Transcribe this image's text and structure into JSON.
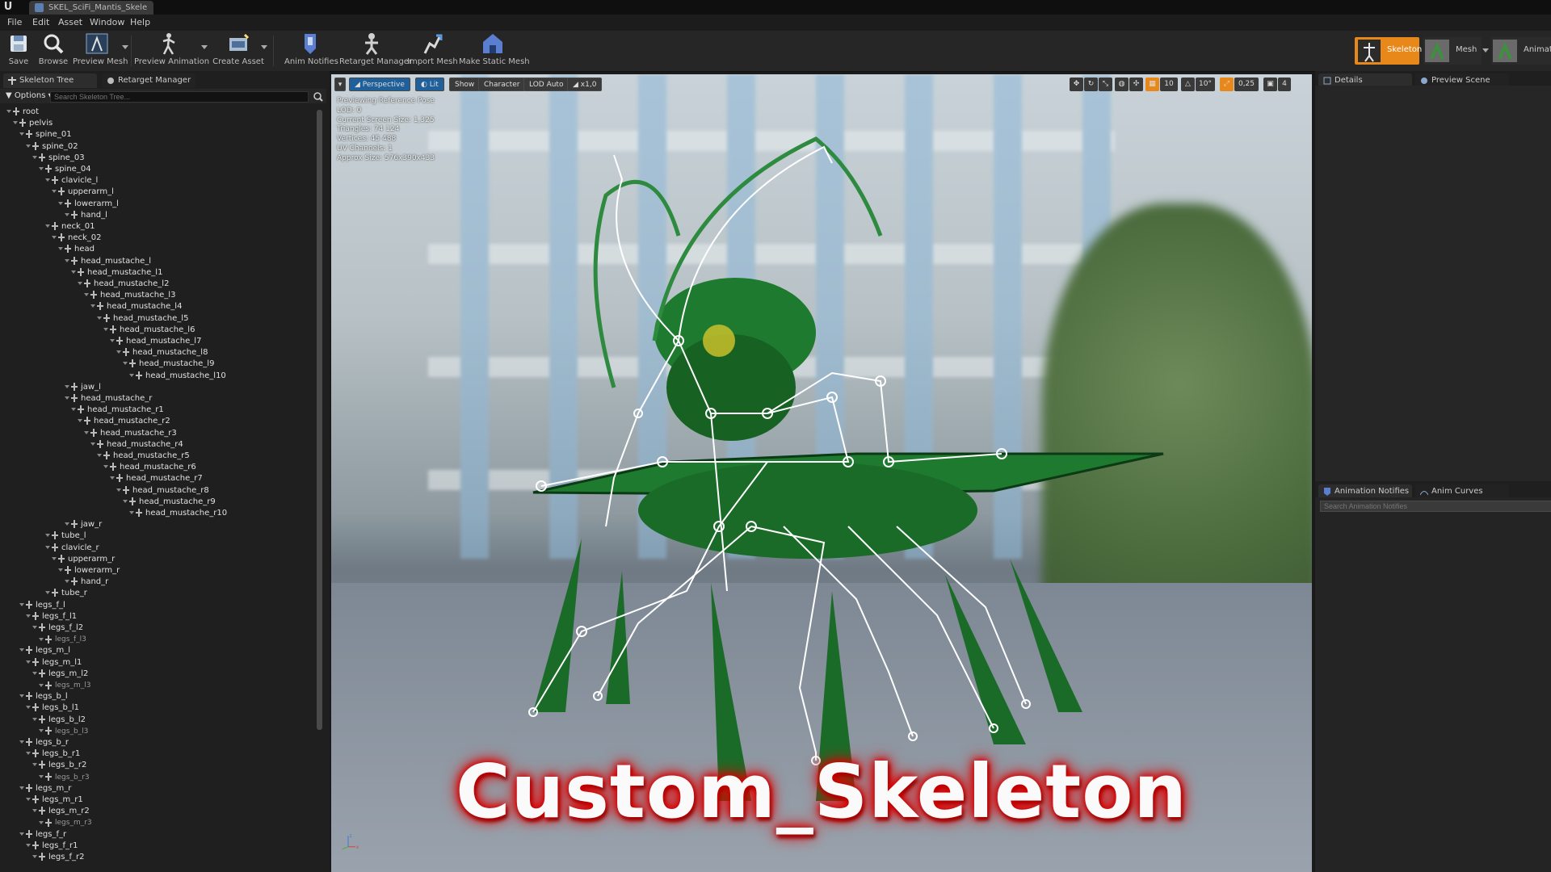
{
  "window": {
    "tab_title": "SKEL_SciFi_Mantis_Skele"
  },
  "menu": [
    "File",
    "Edit",
    "Asset",
    "Window",
    "Help"
  ],
  "toolbar": {
    "buttons": [
      {
        "label": "Save",
        "icon": "save-icon"
      },
      {
        "label": "Browse",
        "icon": "browse-icon"
      },
      {
        "label": "Preview Mesh",
        "icon": "preview-mesh-icon"
      },
      {
        "label": "Preview Animation",
        "icon": "preview-animation-icon"
      },
      {
        "label": "Create Asset",
        "icon": "create-asset-icon"
      },
      {
        "label": "Anim Notifies",
        "icon": "anim-notifies-icon"
      },
      {
        "label": "Retarget Manager",
        "icon": "retarget-manager-icon"
      },
      {
        "label": "Import Mesh",
        "icon": "import-mesh-icon"
      },
      {
        "label": "Make Static Mesh",
        "icon": "make-static-mesh-icon"
      }
    ],
    "modes": [
      {
        "label": "Skeleton",
        "active": true
      },
      {
        "label": "Mesh",
        "active": false
      },
      {
        "label": "Animati",
        "active": false
      }
    ]
  },
  "left_panel": {
    "tabs": [
      "Skeleton Tree",
      "Retarget Manager"
    ],
    "options_label": "Options",
    "search_placeholder": "Search Skeleton Tree...",
    "bones": [
      {
        "name": "root",
        "depth": 0
      },
      {
        "name": "pelvis",
        "depth": 1
      },
      {
        "name": "spine_01",
        "depth": 2
      },
      {
        "name": "spine_02",
        "depth": 3
      },
      {
        "name": "spine_03",
        "depth": 4
      },
      {
        "name": "spine_04",
        "depth": 5
      },
      {
        "name": "clavicle_l",
        "depth": 6
      },
      {
        "name": "upperarm_l",
        "depth": 7
      },
      {
        "name": "lowerarm_l",
        "depth": 8
      },
      {
        "name": "hand_l",
        "depth": 9
      },
      {
        "name": "neck_01",
        "depth": 6
      },
      {
        "name": "neck_02",
        "depth": 7
      },
      {
        "name": "head",
        "depth": 8
      },
      {
        "name": "head_mustache_l",
        "depth": 9
      },
      {
        "name": "head_mustache_l1",
        "depth": 10
      },
      {
        "name": "head_mustache_l2",
        "depth": 11
      },
      {
        "name": "head_mustache_l3",
        "depth": 12
      },
      {
        "name": "head_mustache_l4",
        "depth": 13
      },
      {
        "name": "head_mustache_l5",
        "depth": 14
      },
      {
        "name": "head_mustache_l6",
        "depth": 15
      },
      {
        "name": "head_mustache_l7",
        "depth": 16
      },
      {
        "name": "head_mustache_l8",
        "depth": 17
      },
      {
        "name": "head_mustache_l9",
        "depth": 18
      },
      {
        "name": "head_mustache_l10",
        "depth": 19
      },
      {
        "name": "jaw_l",
        "depth": 9
      },
      {
        "name": "head_mustache_r",
        "depth": 9
      },
      {
        "name": "head_mustache_r1",
        "depth": 10
      },
      {
        "name": "head_mustache_r2",
        "depth": 11
      },
      {
        "name": "head_mustache_r3",
        "depth": 12
      },
      {
        "name": "head_mustache_r4",
        "depth": 13
      },
      {
        "name": "head_mustache_r5",
        "depth": 14
      },
      {
        "name": "head_mustache_r6",
        "depth": 15
      },
      {
        "name": "head_mustache_r7",
        "depth": 16
      },
      {
        "name": "head_mustache_r8",
        "depth": 17
      },
      {
        "name": "head_mustache_r9",
        "depth": 18
      },
      {
        "name": "head_mustache_r10",
        "depth": 19
      },
      {
        "name": "jaw_r",
        "depth": 9
      },
      {
        "name": "tube_l",
        "depth": 6
      },
      {
        "name": "clavicle_r",
        "depth": 6
      },
      {
        "name": "upperarm_r",
        "depth": 7
      },
      {
        "name": "lowerarm_r",
        "depth": 8
      },
      {
        "name": "hand_r",
        "depth": 9
      },
      {
        "name": "tube_r",
        "depth": 6
      },
      {
        "name": "legs_f_l",
        "depth": 2
      },
      {
        "name": "legs_f_l1",
        "depth": 3
      },
      {
        "name": "legs_f_l2",
        "depth": 4
      },
      {
        "name": "legs_f_l3",
        "depth": 5,
        "dim": true
      },
      {
        "name": "legs_m_l",
        "depth": 2
      },
      {
        "name": "legs_m_l1",
        "depth": 3
      },
      {
        "name": "legs_m_l2",
        "depth": 4
      },
      {
        "name": "legs_m_l3",
        "depth": 5,
        "dim": true
      },
      {
        "name": "legs_b_l",
        "depth": 2
      },
      {
        "name": "legs_b_l1",
        "depth": 3
      },
      {
        "name": "legs_b_l2",
        "depth": 4
      },
      {
        "name": "legs_b_l3",
        "depth": 5,
        "dim": true
      },
      {
        "name": "legs_b_r",
        "depth": 2
      },
      {
        "name": "legs_b_r1",
        "depth": 3
      },
      {
        "name": "legs_b_r2",
        "depth": 4
      },
      {
        "name": "legs_b_r3",
        "depth": 5,
        "dim": true
      },
      {
        "name": "legs_m_r",
        "depth": 2
      },
      {
        "name": "legs_m_r1",
        "depth": 3
      },
      {
        "name": "legs_m_r2",
        "depth": 4
      },
      {
        "name": "legs_m_r3",
        "depth": 5,
        "dim": true
      },
      {
        "name": "legs_f_r",
        "depth": 2
      },
      {
        "name": "legs_f_r1",
        "depth": 3
      },
      {
        "name": "legs_f_r2",
        "depth": 4
      }
    ]
  },
  "viewport": {
    "buttons": {
      "perspective": "Perspective",
      "lit": "Lit",
      "show": "Show",
      "character": "Character",
      "lod": "LOD Auto",
      "speed": "x1,0"
    },
    "right_tools": {
      "grid": "10",
      "angle": "10°",
      "scale": "0,25",
      "camera": "4"
    },
    "stats": [
      "Previewing Reference Pose",
      "LOD: 0",
      "Current Screen Size: 1,325",
      "Triangles: 74 124",
      "Vertices: 45 488",
      "UV Channels: 1",
      "Approx Size: 576x390x433"
    ],
    "overlay_title": "Custom_Skeleton",
    "axis_labels": {
      "z": "z",
      "x": "x"
    }
  },
  "right_panel": {
    "top_tabs": [
      "Details",
      "Preview Scene Sett"
    ],
    "bottom_tabs": [
      "Animation Notifies",
      "Anim Curves"
    ],
    "notifies_search_placeholder": "Search Animation Notifies"
  },
  "colors": {
    "accent_orange": "#e8881a",
    "lit_blue": "#1f5f9a",
    "title_glow": "#cc0000",
    "mantis_green": "#1e7a2e"
  }
}
